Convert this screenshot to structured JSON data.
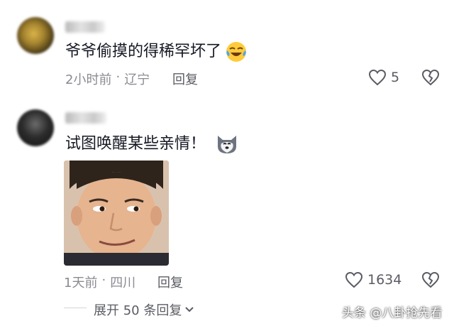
{
  "comments": [
    {
      "text": "爷爷偷摸的得稀罕坏了",
      "emoji": "laughing-crying-emoji",
      "time": "2小时前",
      "location": "辽宁",
      "reply_label": "回复",
      "likes": "5"
    },
    {
      "text": "试图唤醒某些亲情！",
      "emoji": "husky-dog-emoji",
      "time": "1天前",
      "location": "四川",
      "reply_label": "回复",
      "likes": "1634",
      "image": "smirking-man-meme"
    }
  ],
  "separator": "·",
  "expand_label": "展开 50 条回复",
  "watermark": "头条 @八卦抢先看",
  "icons": {
    "like": "heart-outline-icon",
    "dislike": "broken-heart-icon",
    "expand": "chevron-down-icon"
  }
}
